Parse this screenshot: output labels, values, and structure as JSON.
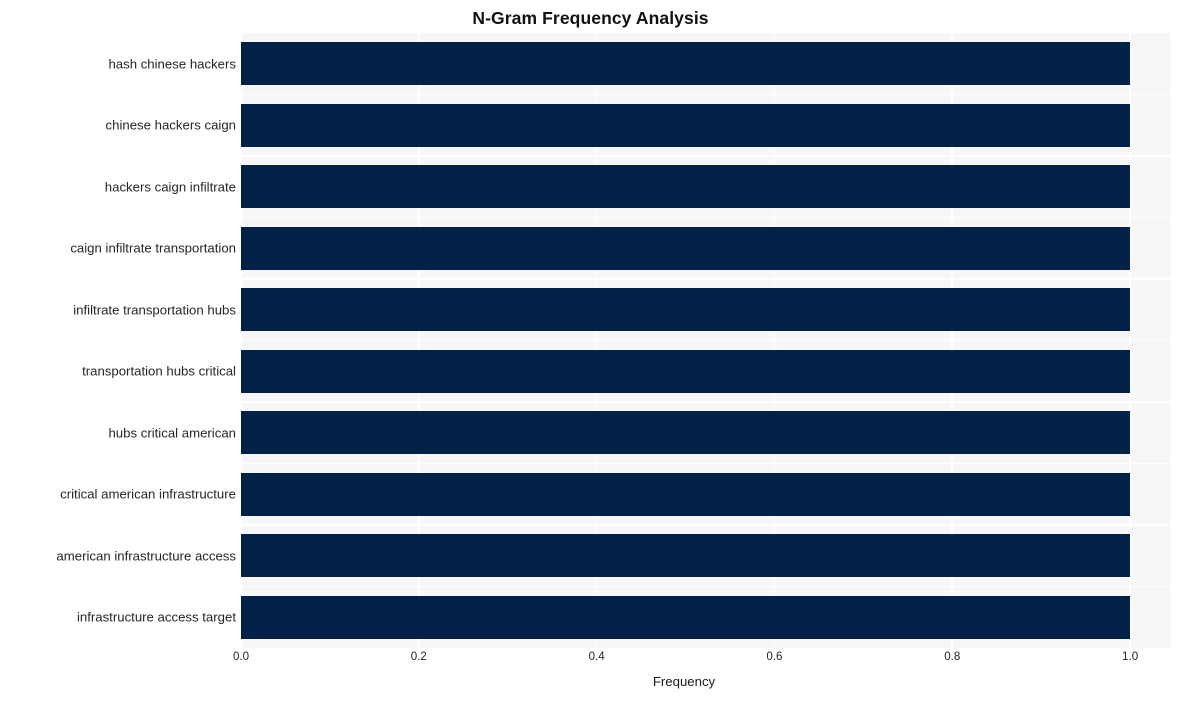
{
  "chart_data": {
    "type": "bar",
    "orientation": "horizontal",
    "title": "N-Gram Frequency Analysis",
    "xlabel": "Frequency",
    "ylabel": "",
    "categories": [
      "hash chinese hackers",
      "chinese hackers caign",
      "hackers caign infiltrate",
      "caign infiltrate transportation",
      "infiltrate transportation hubs",
      "transportation hubs critical",
      "hubs critical american",
      "critical american infrastructure",
      "american infrastructure access",
      "infrastructure access target"
    ],
    "values": [
      1.0,
      1.0,
      1.0,
      1.0,
      1.0,
      1.0,
      1.0,
      1.0,
      1.0,
      1.0
    ],
    "xlim": [
      0.0,
      1.046
    ],
    "xticks": [
      0.0,
      0.2,
      0.4,
      0.6,
      0.8,
      1.0
    ],
    "xtick_labels": [
      "0.0",
      "0.2",
      "0.4",
      "0.6",
      "0.8",
      "1.0"
    ],
    "grid": true,
    "grid_color": "#ffffff",
    "legend": false,
    "bar_color": "#012149",
    "plot_background": "#f7f7f7",
    "figure_background": "#ffffff"
  }
}
